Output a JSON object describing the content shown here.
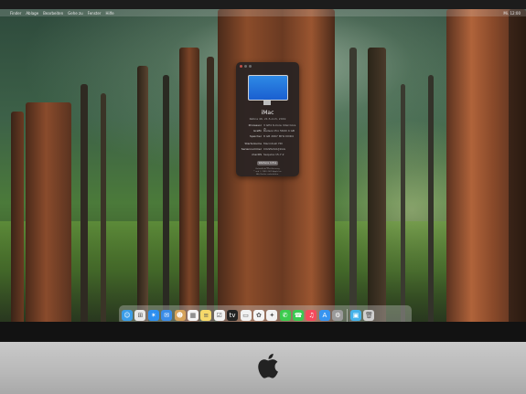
{
  "menubar": {
    "apple": "",
    "items": [
      "Finder",
      "Ablage",
      "Bearbeiten",
      "Gehe zu",
      "Fenster",
      "Hilfe"
    ],
    "right": "Mi. 12:00"
  },
  "about": {
    "title": "iMac",
    "subtitle": "Retina 4K, 21.5-inch, 2019",
    "specs": [
      {
        "k": "Prozessor",
        "v": "3 GHz 6-Core Intel Core i5"
      },
      {
        "k": "Grafik",
        "v": "Radeon Pro 560X 4 GB"
      },
      {
        "k": "Speicher",
        "v": "8 GB 2667 MHz DDR4"
      },
      {
        "k": "Startvolume",
        "v": "Macintosh HD"
      },
      {
        "k": "Seriennummer",
        "v": "C02ZG3AUJ1GG"
      },
      {
        "k": "macOS",
        "v": "Sequoia 15.7.2"
      }
    ],
    "button": "Weitere Infos …",
    "legal": "Behördliche Zertifizierung\n™ und © 1983–2025 Apple Inc.\nAlle Rechte vorbehalten."
  },
  "dock": {
    "icons": [
      {
        "name": "finder-icon",
        "color": "#3a9de8",
        "glyph": "☺"
      },
      {
        "name": "launchpad-icon",
        "color": "#e8e8e8",
        "glyph": "⊞"
      },
      {
        "name": "safari-icon",
        "color": "#2d8ff0",
        "glyph": "✶"
      },
      {
        "name": "mail-icon",
        "color": "#3b8de8",
        "glyph": "✉"
      },
      {
        "name": "contacts-icon",
        "color": "#d6a35a",
        "glyph": "☻"
      },
      {
        "name": "calendar-icon",
        "color": "#f4f4f4",
        "glyph": "▦"
      },
      {
        "name": "notes-icon",
        "color": "#f6d96a",
        "glyph": "≡"
      },
      {
        "name": "reminders-icon",
        "color": "#f2f2f2",
        "glyph": "☑"
      },
      {
        "name": "apple-tv-icon",
        "color": "#222222",
        "glyph": "tv"
      },
      {
        "name": "music-icon",
        "color": "#f1f1f1",
        "glyph": "▭"
      },
      {
        "name": "photos-icon",
        "color": "#f5f5f5",
        "glyph": "✿"
      },
      {
        "name": "facetime-icon",
        "color": "#f2f2f2",
        "glyph": "✦"
      },
      {
        "name": "messages-icon",
        "color": "#3ccb4e",
        "glyph": "✆"
      },
      {
        "name": "maps-icon",
        "color": "#3bc951",
        "glyph": "☎"
      },
      {
        "name": "itunes-icon",
        "color": "#f44a5c",
        "glyph": "♫"
      },
      {
        "name": "app-store-icon",
        "color": "#3794f0",
        "glyph": "A"
      },
      {
        "name": "system-settings-icon",
        "color": "#9a9a9a",
        "glyph": "⚙"
      },
      {
        "name": "downloads-folder-icon",
        "color": "#45b2ea",
        "glyph": "▣"
      },
      {
        "name": "trash-icon",
        "color": "#cfcfcf",
        "glyph": "🗑"
      }
    ]
  }
}
